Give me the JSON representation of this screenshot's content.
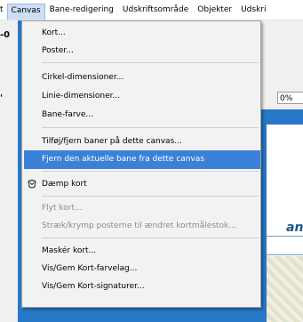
{
  "menubar": {
    "items": [
      "t",
      "Canvas",
      "Bane-redigering",
      "Udskriftsområde",
      "Objekter",
      "Udskri"
    ]
  },
  "left_fragments": [
    "-0",
    "'"
  ],
  "zoom_value": "0%",
  "canvas": {
    "title_fragment": "an"
  },
  "menu": {
    "items": [
      {
        "label": "Kort..."
      },
      {
        "label": "Poster..."
      },
      {
        "label": "Cirkel-dimensioner..."
      },
      {
        "label": "Linie-dimensioner..."
      },
      {
        "label": "Bane-farve..."
      },
      {
        "label": "Tilføj/fjern baner på dette canvas..."
      },
      {
        "label": "Fjern den aktuelle bane fra dette canvas"
      },
      {
        "label": "Dæmp kort"
      },
      {
        "label": "Flyt kort..."
      },
      {
        "label": "Stræk/krymp posterne til ændret kortmålestok..."
      },
      {
        "label": "Maskér kort..."
      },
      {
        "label": "Vis/Gem Kort-farvelag..."
      },
      {
        "label": "Vis/Gem Kort-signaturer..."
      }
    ],
    "checked_item": "Dæmp kort",
    "highlighted_item": "Fjern den aktuelle bane fra dette canvas",
    "disabled_items": [
      "Flyt kort...",
      "Stræk/krymp posterne til ændret kortmålestok..."
    ]
  },
  "colors": {
    "highlight": "#3b82d6",
    "menu_background": "#f2f2f2",
    "active_menu_background": "#ccdef5",
    "workspace": "#2878c8"
  }
}
